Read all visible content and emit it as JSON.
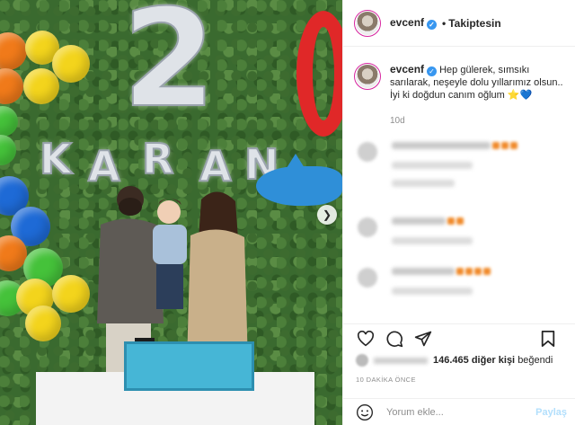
{
  "post": {
    "username": "evcenf",
    "header_follow_status": "Takiptesin",
    "caption": "Hep gülerek, sımsıkı sarılarak, neşeyle dolu yıllarımız olsun.. İyi ki doğdun canım oğlum",
    "caption_emoji_star": "⭐",
    "caption_emoji_heart": "💙",
    "age": "10d",
    "likes_count_text": "146.465 diğer kişi",
    "likes_suffix": "beğendi",
    "timestamp": "10 DAKİKA ÖNCE",
    "comment_placeholder": "Yorum ekle...",
    "share_label": "Paylaş"
  },
  "media": {
    "balloon_number": "2",
    "banner_letters": [
      "K",
      "A",
      "R",
      "A",
      "N"
    ]
  },
  "icons": {
    "verified": "verified-badge-icon",
    "next": "chevron-right-icon",
    "like": "heart-outline-icon",
    "comment": "comment-bubble-icon",
    "share": "paper-plane-icon",
    "save": "bookmark-icon",
    "emoji": "smiley-icon"
  },
  "colors": {
    "verified": "#3897f0",
    "share_disabled": "#b2dffc",
    "muted": "#8e8e8e"
  }
}
